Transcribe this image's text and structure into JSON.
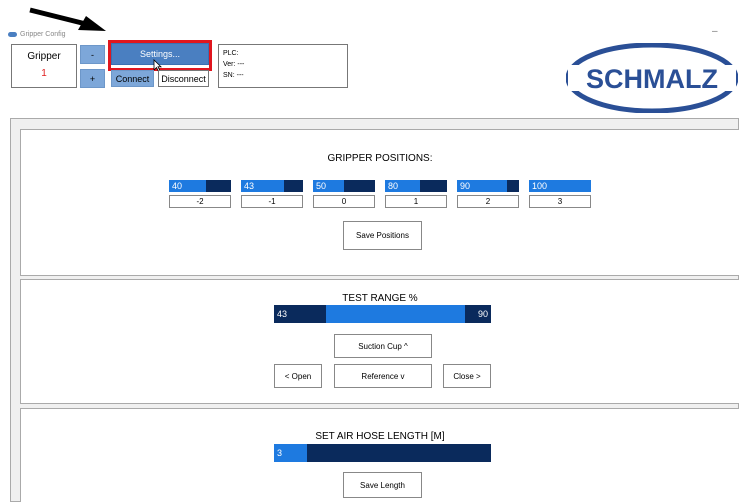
{
  "window": {
    "title": "Gripper Config",
    "minimize_glyph": "–"
  },
  "gripper": {
    "label": "Gripper",
    "value": "1",
    "minus_label": "-",
    "plus_label": "+"
  },
  "toolbar": {
    "settings_label": "Settings...",
    "connect_label": "Connect",
    "disconnect_label": "Disconnect"
  },
  "plc": {
    "plc_line": "PLC:",
    "ver_line": "Ver: ---",
    "sn_line": "SN: ---"
  },
  "logo": {
    "text": "SCHMALZ",
    "color": "#2a4f96"
  },
  "positions": {
    "title": "GRIPPER POSITIONS:",
    "items": [
      {
        "value": "40",
        "label": "-2",
        "fill_fraction": 0.6
      },
      {
        "value": "43",
        "label": "-1",
        "fill_fraction": 0.7
      },
      {
        "value": "50",
        "label": "0",
        "fill_fraction": 0.5
      },
      {
        "value": "80",
        "label": "1",
        "fill_fraction": 0.57
      },
      {
        "value": "90",
        "label": "2",
        "fill_fraction": 0.8
      },
      {
        "value": "100",
        "label": "3",
        "fill_fraction": 1.0
      }
    ],
    "save_label": "Save Positions"
  },
  "test_range": {
    "title": "TEST RANGE %",
    "low": "43",
    "high": "90",
    "low_fraction": 0.24,
    "high_fraction": 0.88,
    "suction_label": "Suction Cup ^",
    "open_label": "< Open",
    "reference_label": "Reference v",
    "close_label": "Close >"
  },
  "hose": {
    "title": "SET AIR HOSE LENGTH [M]",
    "value": "3",
    "fill_fraction": 0.15,
    "save_label": "Save Length"
  },
  "colors": {
    "accent": "#4a7fc1",
    "button_light": "#7da7d9",
    "bar_dark": "#0a2a5c",
    "bar_fill": "#1e7ae0",
    "highlight": "#e0161e",
    "gripper_value": "#e02020"
  },
  "icons": {
    "annotation": "arrow-icon",
    "pointer": "mouse-cursor-icon",
    "app": "app-icon"
  }
}
